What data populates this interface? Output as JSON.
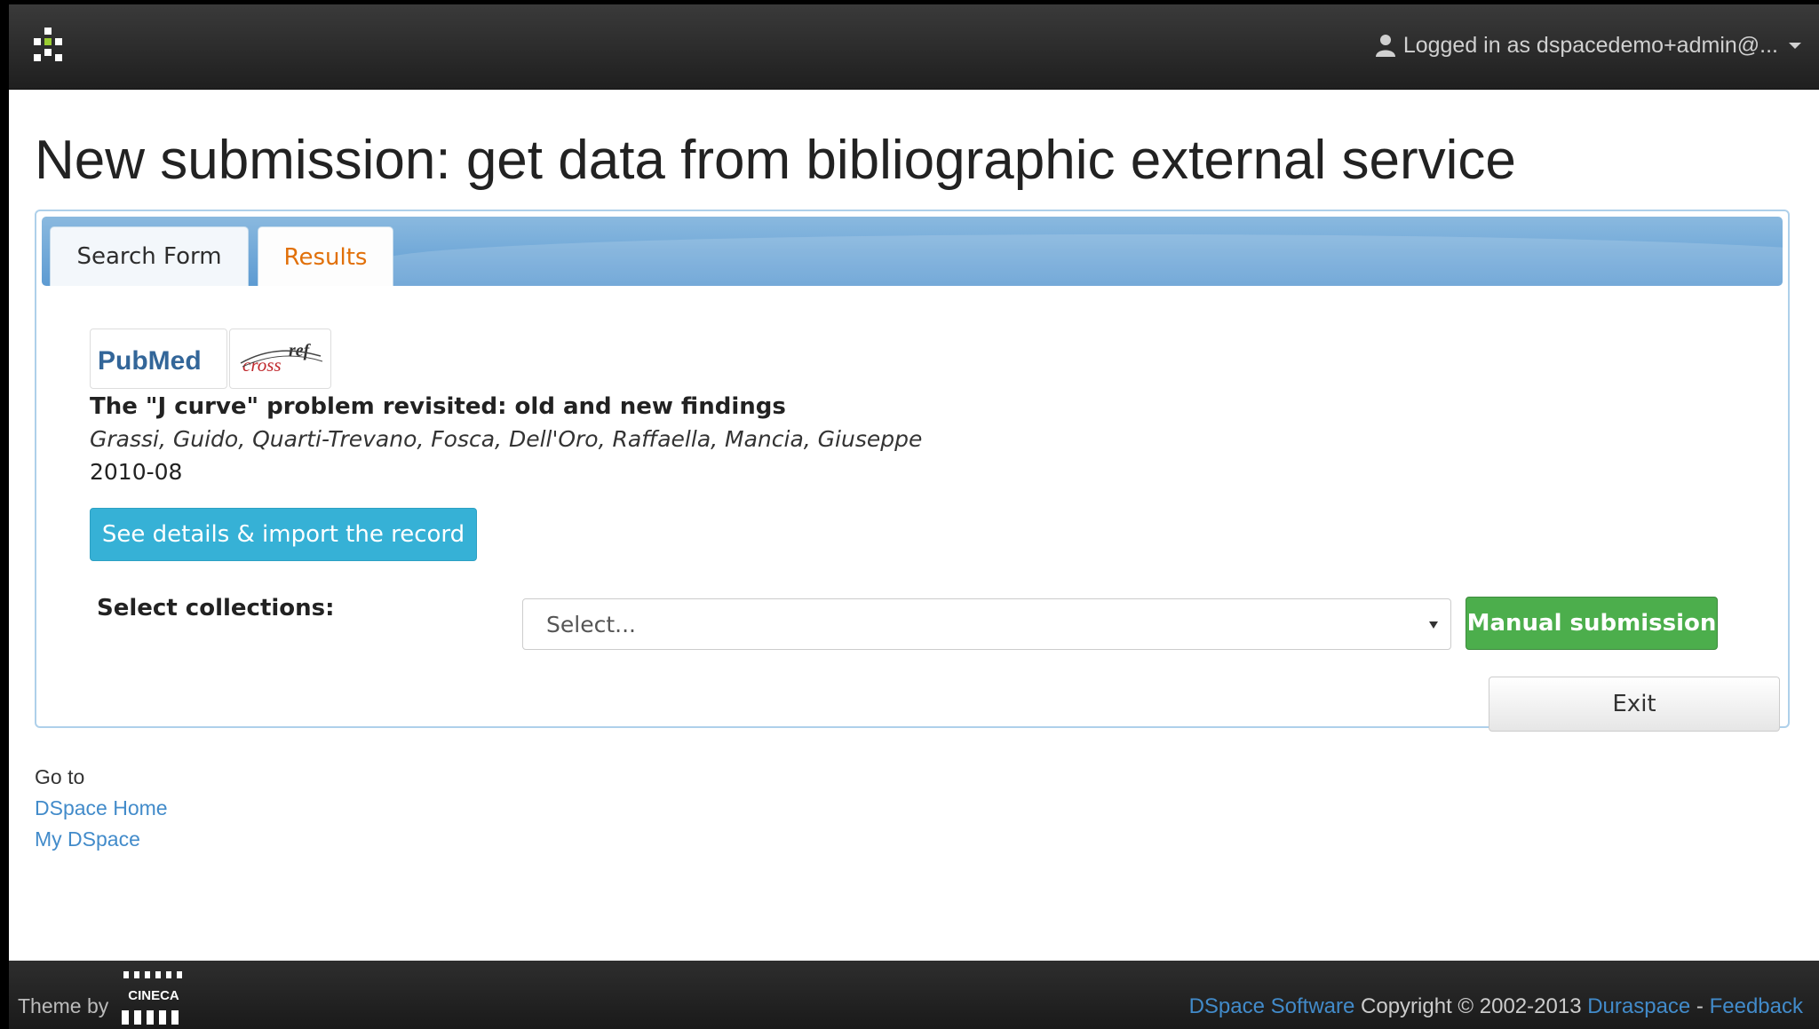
{
  "navbar": {
    "user_label": "Logged in as dspacedemo+admin@..."
  },
  "page": {
    "title": "New submission: get data from bibliographic external service"
  },
  "tabs": [
    {
      "label": "Search Form"
    },
    {
      "label": "Results"
    }
  ],
  "logos": {
    "pubmed": "PubMed",
    "crossref_top": "ref",
    "crossref_bottom": "cross"
  },
  "record": {
    "title": "The \"J curve\" problem revisited: old and new findings",
    "authors": "Grassi, Guido, Quarti-Trevano, Fosca, Dell'Oro, Raffaella, Mancia, Giuseppe",
    "date": "2010-08",
    "import_button": "See details & import the record"
  },
  "collections": {
    "label": "Select collections:",
    "placeholder": "Select...",
    "manual_button": "Manual submission",
    "exit_button": "Exit"
  },
  "goto": {
    "label": "Go to",
    "home": "DSpace Home",
    "mydspace": "My DSpace"
  },
  "footer": {
    "theme_by": "Theme by",
    "cineca": "CINECA",
    "dspace_software": "DSpace Software",
    "copyright": " Copyright © 2002-2013 ",
    "duraspace": "Duraspace",
    "separator": " - ",
    "feedback": "Feedback"
  },
  "colors": {
    "accent_orange": "#e17009",
    "link_blue": "#428bca",
    "success_green": "#4cae4c",
    "info_blue": "#36b1d6",
    "pubmed_blue": "#336699",
    "crossref_red": "#c0282c"
  }
}
